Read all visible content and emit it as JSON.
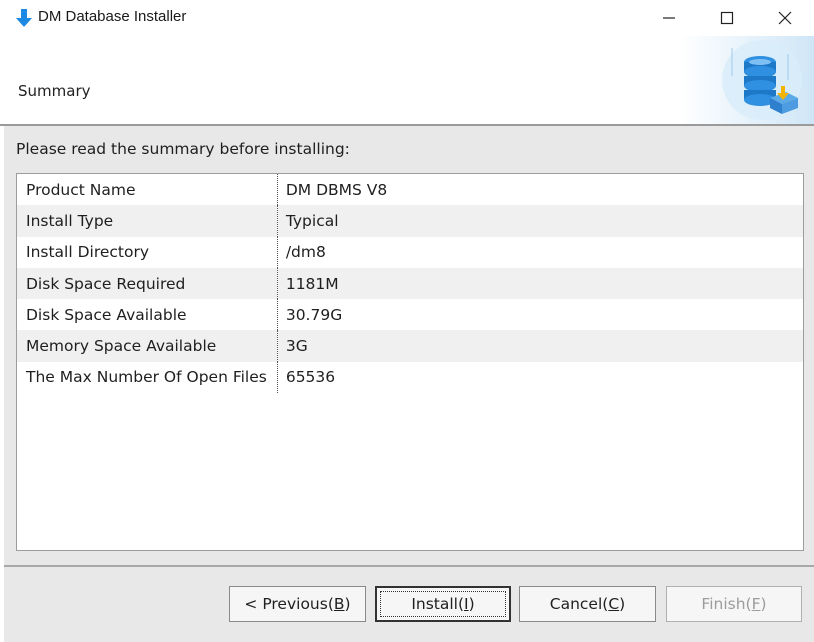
{
  "window": {
    "title": "DM Database Installer",
    "controls": {
      "minimize": "minimize-icon",
      "maximize": "maximize-icon",
      "close": "close-icon"
    }
  },
  "header": {
    "heading": "Summary",
    "decoration_icon": "database-install-icon"
  },
  "instruction": "Please read the summary before installing:",
  "summary_rows": [
    {
      "key": "Product Name",
      "value": "DM DBMS V8"
    },
    {
      "key": "Install Type",
      "value": "Typical"
    },
    {
      "key": "Install Directory",
      "value": "/dm8"
    },
    {
      "key": "Disk Space Required",
      "value": "1181M"
    },
    {
      "key": "Disk Space Available",
      "value": "30.79G"
    },
    {
      "key": "Memory Space Available",
      "value": "3G"
    },
    {
      "key": "The Max Number Of Open Files",
      "value": "65536"
    }
  ],
  "buttons": {
    "previous": {
      "pre": "< Previous(",
      "mnemonic": "B",
      "post": ")"
    },
    "install": {
      "pre": "Install(",
      "mnemonic": "I",
      "post": ")"
    },
    "cancel": {
      "pre": "Cancel(",
      "mnemonic": "C",
      "post": ")"
    },
    "finish": {
      "pre": "Finish(",
      "mnemonic": "F",
      "post": ")",
      "enabled": false
    }
  },
  "colors": {
    "accent_blue": "#1e88e5",
    "panel_bg": "#e8e8e8"
  }
}
